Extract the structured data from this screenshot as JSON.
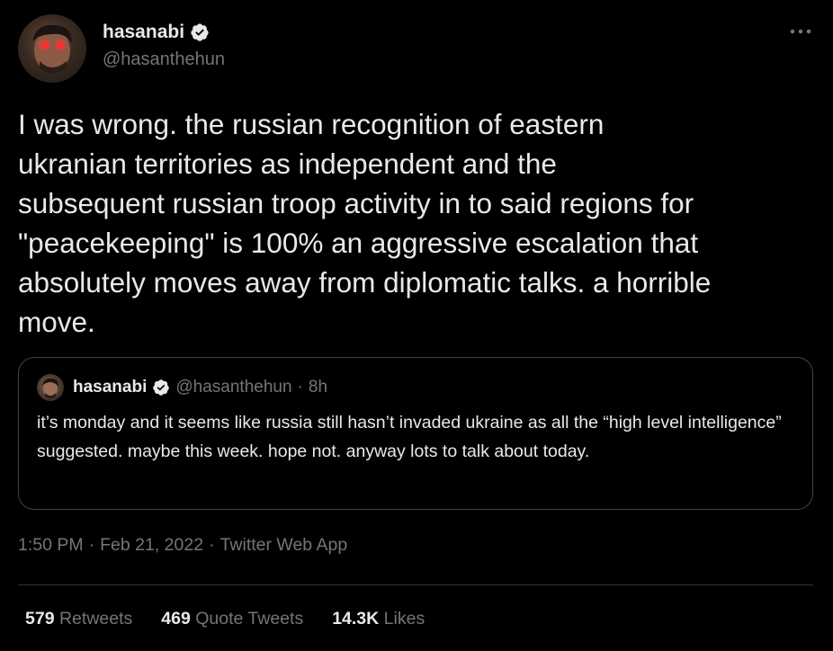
{
  "author": {
    "name": "hasanabi",
    "handle": "@hasanthehun",
    "verified": true
  },
  "menu": {
    "icon": "more-horizontal-icon"
  },
  "tweet": {
    "text": "I was wrong. the russian recognition of eastern\nukranian territories as independent and the\nsubsequent russian troop activity in to said regions for\n\"peacekeeping\" is 100% an aggressive escalation that\nabsolutely moves away from diplomatic talks. a horrible\nmove.",
    "time": "1:50 PM",
    "date": "Feb 21, 2022",
    "source": "Twitter Web App",
    "separator": "·"
  },
  "quoted_tweet": {
    "name": "hasanabi",
    "handle": "@hasanthehun",
    "separator": "·",
    "time": "8h",
    "text": "it’s monday and it seems like russia still hasn’t invaded ukraine as all the “high level intelligence” suggested. maybe this week. hope not. anyway lots to talk about today."
  },
  "stats": {
    "retweets_count": "579",
    "retweets_label": "Retweets",
    "quotes_count": "469",
    "quotes_label": "Quote Tweets",
    "likes_count": "14.3K",
    "likes_label": "Likes"
  },
  "colors": {
    "background": "#000000",
    "text": "#e7e9ea",
    "muted": "#71767b",
    "border": "#3e4144",
    "verified_badge": "#e7e9ea"
  }
}
